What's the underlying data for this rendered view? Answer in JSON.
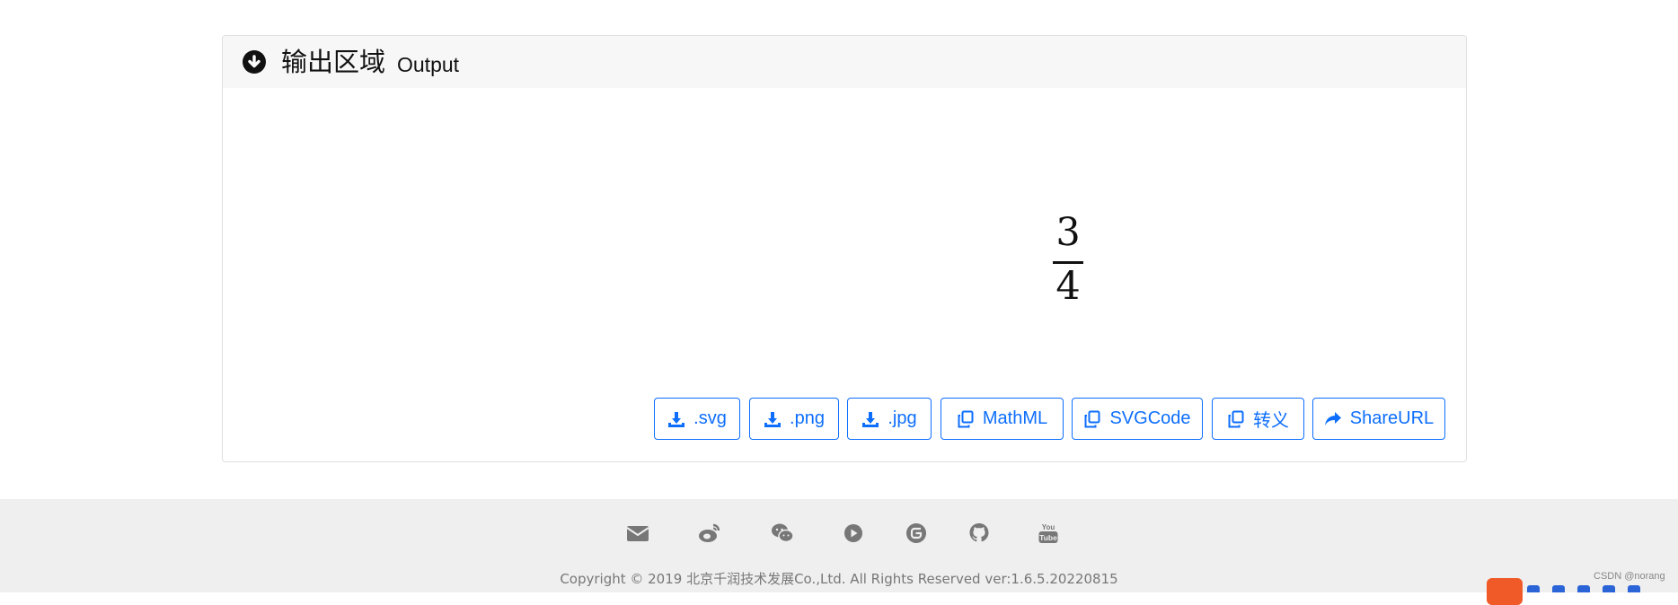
{
  "panel": {
    "title": "输出区域",
    "subtitle": "Output"
  },
  "formula": {
    "numerator": "3",
    "denominator": "4"
  },
  "buttons": {
    "svg": ".svg",
    "png": ".png",
    "jpg": ".jpg",
    "mathml": "MathML",
    "svgcode": "SVGCode",
    "escape": "转义",
    "shareurl": "ShareURL"
  },
  "icons": {
    "header": "arrow-circle-down-icon",
    "download": "download-icon",
    "copy": "copy-icon",
    "share": "share-icon",
    "social": [
      "envelope-icon",
      "weibo-icon",
      "wechat-icon",
      "video-icon",
      "gitee-icon",
      "github-icon",
      "youtube-icon"
    ]
  },
  "footer": {
    "copyright": "Copyright © 2019 北京千润技术发展Co.,Ltd. All Rights Reserved  ver:1.6.5.20220815"
  },
  "watermark": "CSDN @norang",
  "colors": {
    "accent": "#0d6efd",
    "header_bg": "#f7f7f7",
    "footer_bg": "#efefef",
    "footer_icon": "#777777",
    "badge": "#f05a28"
  }
}
